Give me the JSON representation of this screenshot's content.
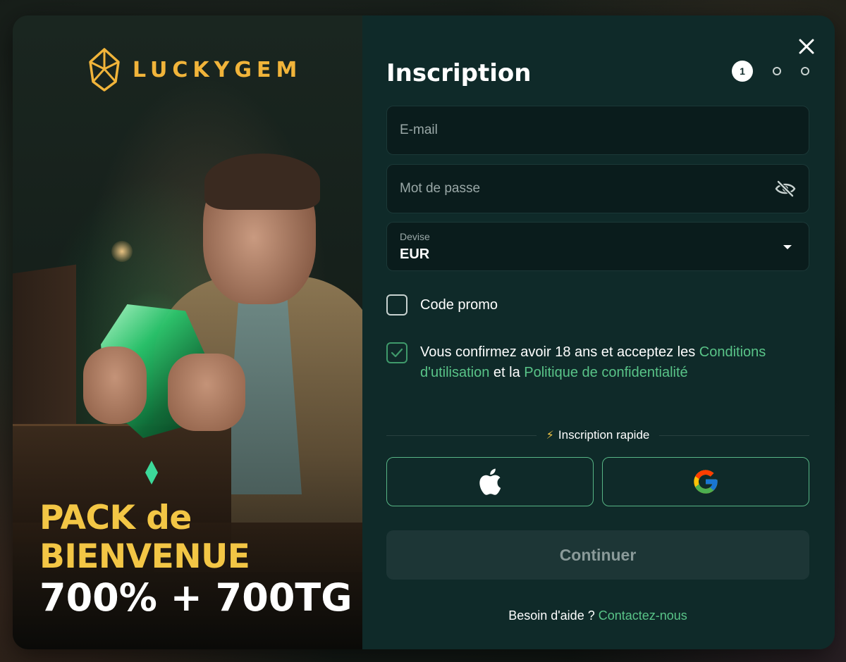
{
  "brand": {
    "name": "LUCKYGEM"
  },
  "promo": {
    "line1": "PACK de",
    "line2": "BIENVENUE",
    "line3": "700% + 700TG"
  },
  "form": {
    "title": "Inscription",
    "steps": [
      {
        "label": "1",
        "active": true
      },
      {
        "label": "",
        "active": false
      },
      {
        "label": "",
        "active": false
      }
    ],
    "email": {
      "placeholder": "E-mail",
      "value": ""
    },
    "password": {
      "placeholder": "Mot de passe",
      "value": "",
      "toggle_icon": "eye-slash-icon"
    },
    "currency": {
      "label": "Devise",
      "value": "EUR"
    },
    "promo_code": {
      "label": "Code promo",
      "checked": false
    },
    "terms": {
      "checked": true,
      "text_before": "Vous confirmez avoir 18 ans et acceptez les ",
      "terms_link": "Conditions d'utilisation",
      "text_middle": " et la ",
      "privacy_link": "Politique de confidentialité"
    },
    "quick_signup": {
      "icon": "lightning-icon",
      "label": "Inscription rapide"
    },
    "social": [
      {
        "name": "apple",
        "icon": "apple-icon"
      },
      {
        "name": "google",
        "icon": "google-icon"
      }
    ],
    "continue_label": "Continuer",
    "help": {
      "text": "Besoin d'aide ? ",
      "link": "Contactez-nous"
    }
  },
  "colors": {
    "accent_green": "#59c488",
    "brand_gold": "#f1b43a",
    "panel_bg": "#0f2a29"
  }
}
